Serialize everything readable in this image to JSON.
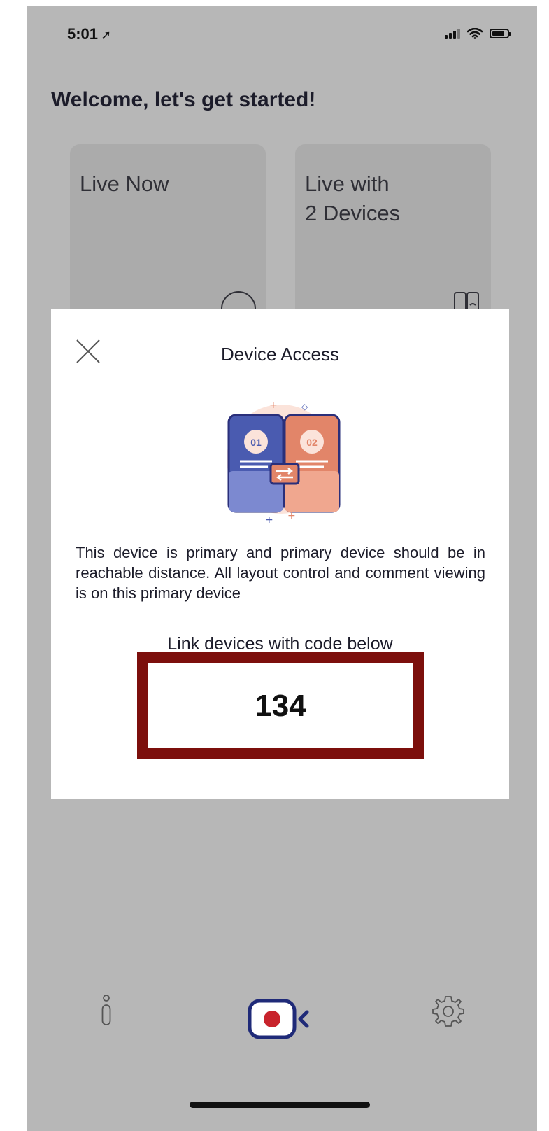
{
  "status_bar": {
    "time": "5:01",
    "location_arrow": "➚"
  },
  "welcome_title": "Welcome, let's get started!",
  "cards": [
    {
      "label": "Live Now",
      "icon": "live-badge-icon"
    },
    {
      "label": "Live with\n2 Devices",
      "icon": "two-devices-icon"
    }
  ],
  "modal": {
    "title": "Device Access",
    "illustration_labels": [
      "01",
      "02"
    ],
    "description": "This device is primary and primary device should be in reachable distance. All layout control and comment viewing is on this primary device",
    "link_label": "Link devices with code below",
    "code": "134",
    "highlight_color": "#7c0f0c"
  },
  "bottom_nav": {
    "items": [
      "info-icon",
      "record-icon",
      "settings-icon"
    ],
    "accent": "#1f2a78",
    "record_dot": "#c8232c"
  }
}
